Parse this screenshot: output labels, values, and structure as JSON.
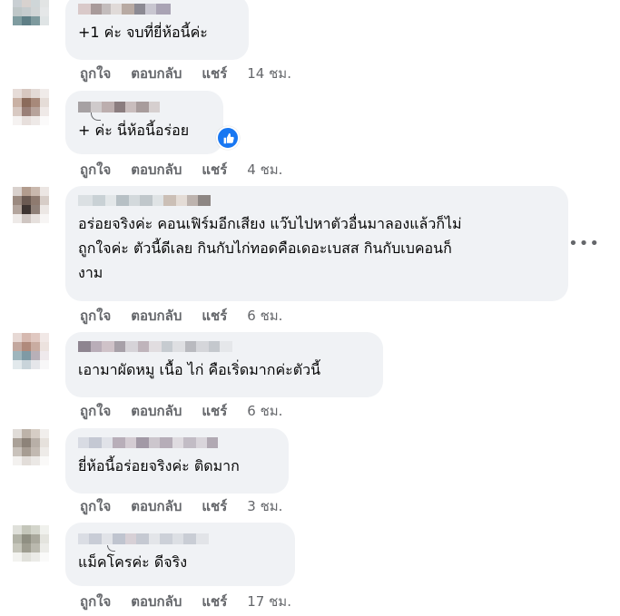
{
  "actions": {
    "like": "ถูกใจ",
    "reply": "ตอบกลับ",
    "share": "แชร์"
  },
  "comments": [
    {
      "text": "+1 ค่ะ จบที่ยี่ห้อนี้ค่ะ",
      "time": "14 ชม."
    },
    {
      "text": "+ ค่ะ นี่ห้อนี้อร่อย",
      "time": "4 ชม.",
      "reaction": "like-icon"
    },
    {
      "text": "อร่อยจริงค่ะ คอนเฟิร์มอีกเสียง แว๊บไปหาตัวอื่นมาลองแล้วก็ไม่\nถูกใจค่ะ ตัวนี้ดีเลย กินกับไก่ทอดคือเดอะเบสส กินกับเบคอนก็\nงาม",
      "time": "6 ชม."
    },
    {
      "text": "เอามาผัดหมู เนื้อ ไก่ คือเริ่ดมากค่ะตัวนี้",
      "time": "6 ชม."
    },
    {
      "text": "ยี่ห้อนี้อร่อยจริงค่ะ ติดมาก",
      "time": "3 ชม."
    },
    {
      "text": "แม็คโครค่ะ ดีจริง",
      "time": "17 ชม."
    }
  ],
  "more_options": "•••",
  "colors": {
    "bubble": "#f0f2f5",
    "meta_text": "#65676b",
    "like_blue": "#1877f2"
  }
}
